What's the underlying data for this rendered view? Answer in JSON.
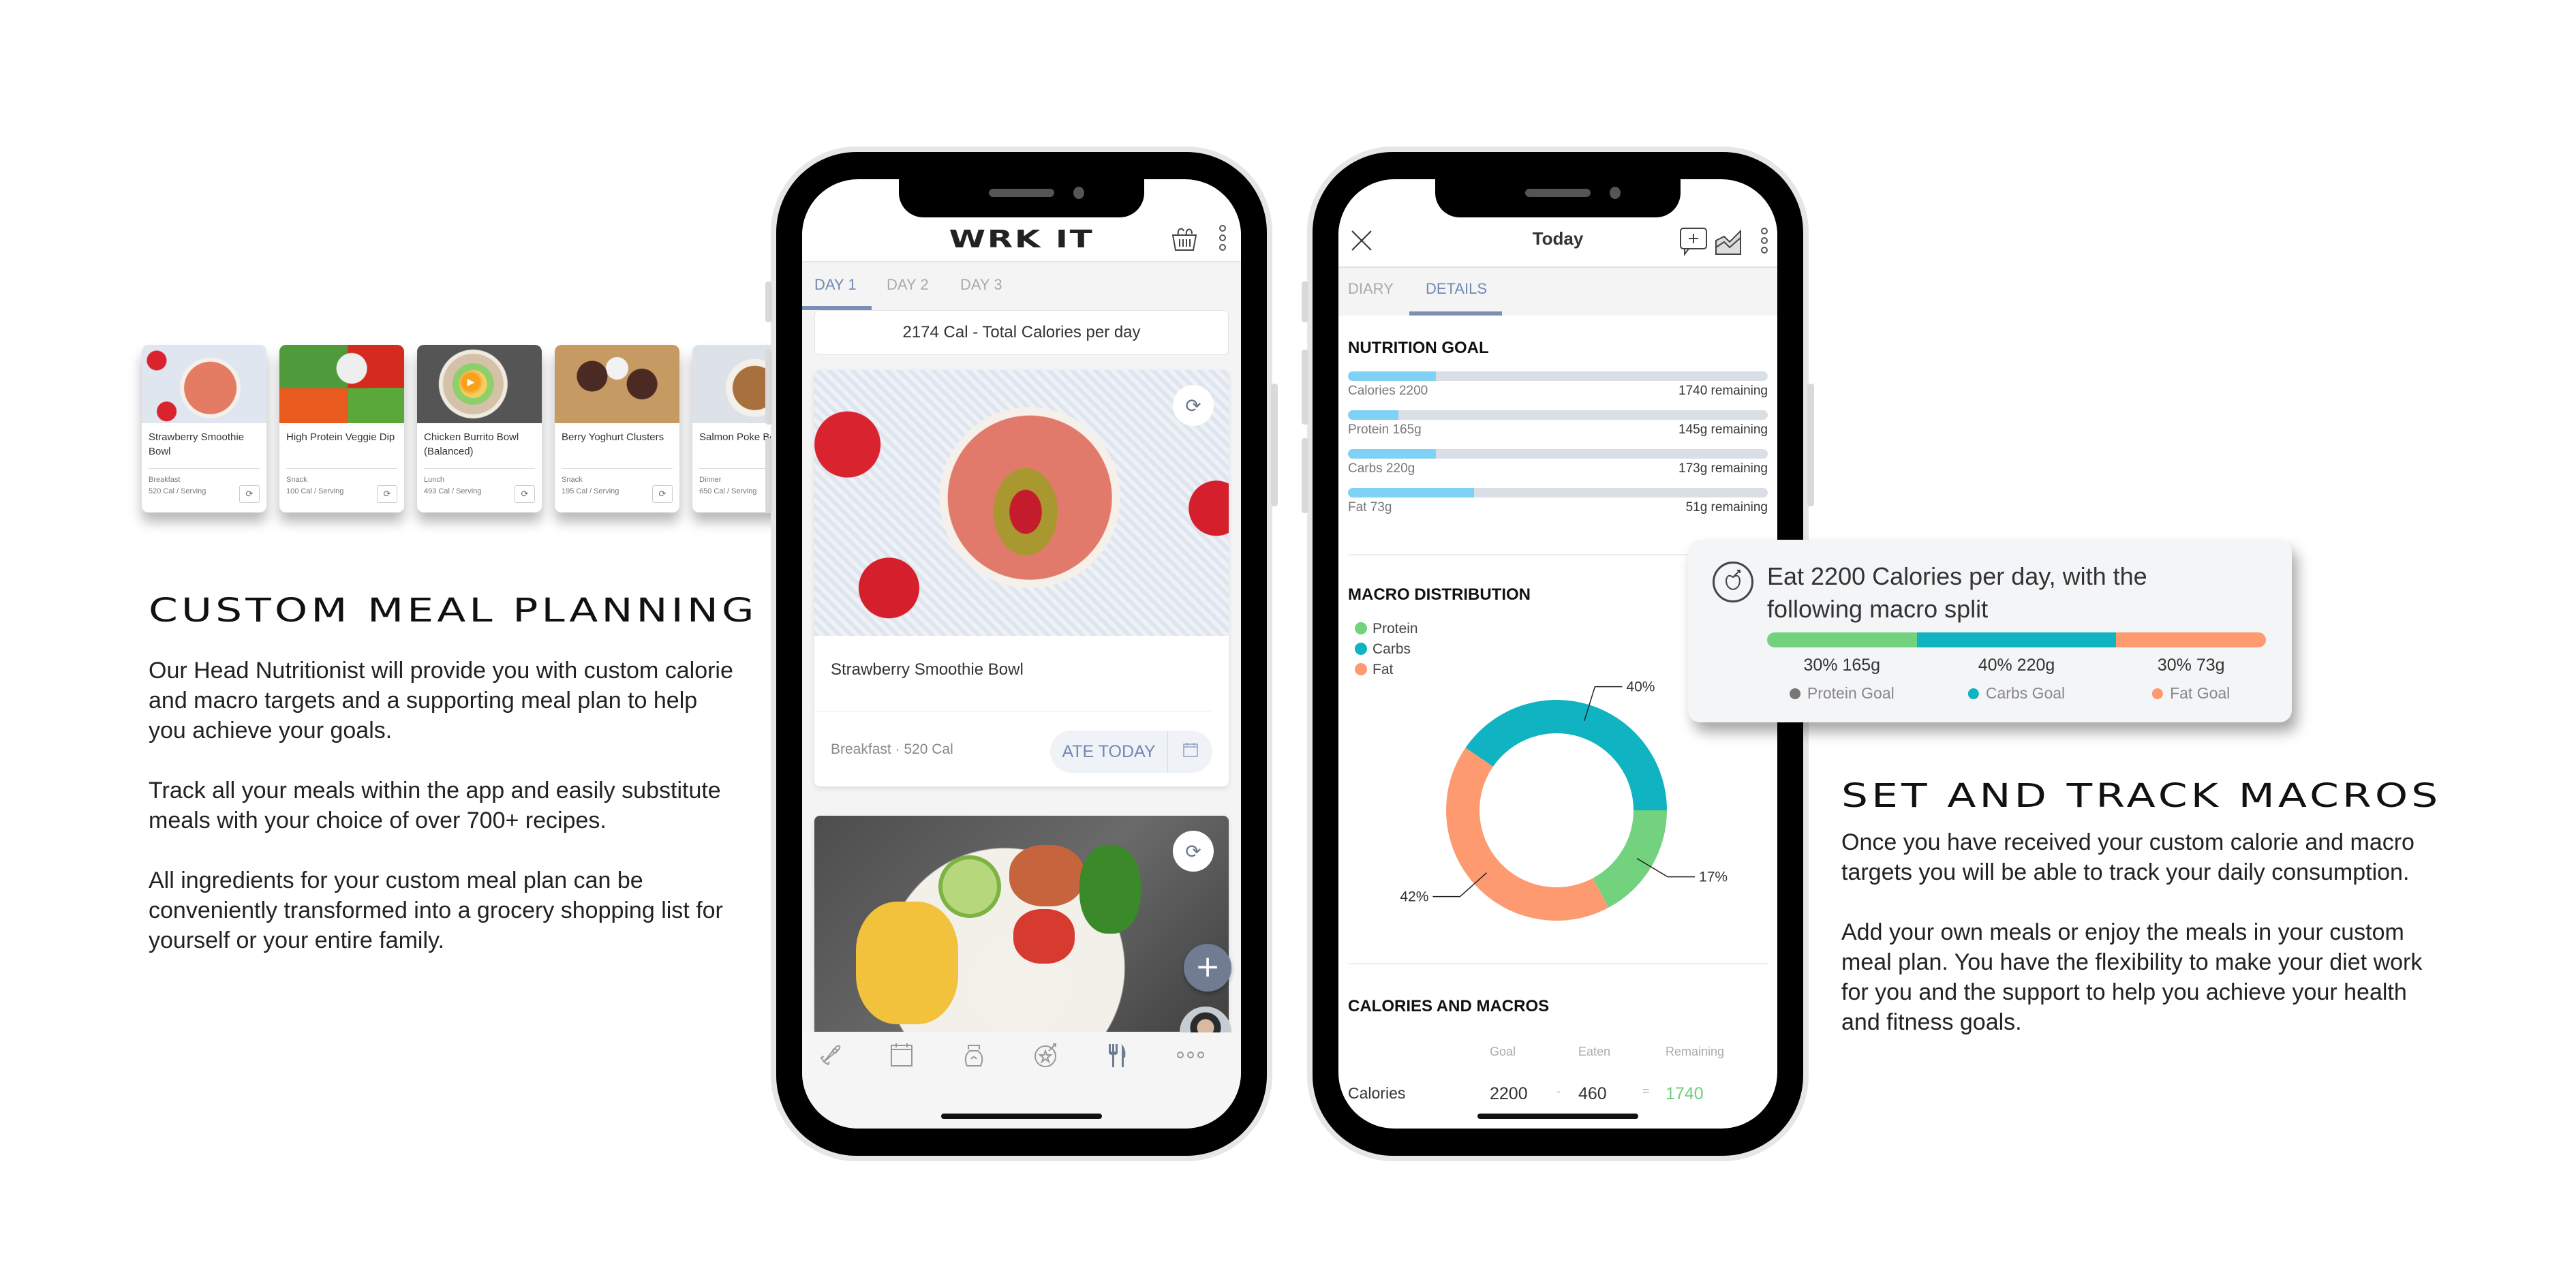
{
  "left_section": {
    "heading": "CUSTOM MEAL PLANNING",
    "paragraphs": [
      "Our Head Nutritionist will provide you with custom calorie and macro targets and a supporting meal plan to help you achieve your goals.",
      "Track all your meals within the app and easily substitute meals with your choice of over 700+ recipes.",
      "All ingredients for your custom meal plan can be conveniently transformed into a grocery shopping list for yourself or your entire family."
    ]
  },
  "right_section": {
    "heading": "SET AND TRACK MACROS",
    "paragraphs": [
      "Once you have received your custom calorie and macro targets you will be able to track your daily consumption.",
      "Add your own meals or enjoy the meals in your custom meal plan. You have the flexibility to make your diet work for you and the support to help you achieve your health and fitness goals."
    ]
  },
  "meal_strip": [
    {
      "name": "Strawberry Smoothie Bowl",
      "meal": "Breakfast",
      "calories": "520 Cal / Serving",
      "video": false
    },
    {
      "name": "High Protein Veggie Dip",
      "meal": "Snack",
      "calories": "100 Cal / Serving",
      "video": false
    },
    {
      "name": "Chicken Burrito Bowl (Balanced)",
      "meal": "Lunch",
      "calories": "493 Cal / Serving",
      "video": true
    },
    {
      "name": "Berry Yoghurt Clusters",
      "meal": "Snack",
      "calories": "195 Cal / Serving",
      "video": false
    },
    {
      "name": "Salmon Poke Bowl",
      "meal": "Dinner",
      "calories": "650 Cal / Serving",
      "video": false
    }
  ],
  "phone1": {
    "app_title": "WRK IT",
    "header_icons": [
      "grocery-basket-icon",
      "more-vertical-icon"
    ],
    "tabs": [
      {
        "label": "DAY 1",
        "active": true
      },
      {
        "label": "DAY 2",
        "active": false
      },
      {
        "label": "DAY 3",
        "active": false
      }
    ],
    "total_calories": "2174 Cal - Total Calories per day",
    "meal_card": {
      "title": "Strawberry Smoothie Bowl",
      "meta": "Breakfast · 520 Cal",
      "ate_today_label": "ATE TODAY"
    },
    "bottom_nav": [
      {
        "icon": "rocket-icon",
        "active": false
      },
      {
        "icon": "calendar-icon",
        "active": false
      },
      {
        "icon": "kettlebell-icon",
        "active": false
      },
      {
        "icon": "goal-star-icon",
        "active": false
      },
      {
        "icon": "fork-knife-icon",
        "active": true
      },
      {
        "icon": "more-horizontal-icon",
        "active": false
      }
    ],
    "fab_label": "+"
  },
  "phone2": {
    "title": "Today",
    "tabs": [
      {
        "label": "DIARY",
        "active": false
      },
      {
        "label": "DETAILS",
        "active": true
      }
    ],
    "nutrition_goal": {
      "title": "NUTRITION GOAL",
      "rows": [
        {
          "label": "Calories 2200",
          "remaining": "1740 remaining",
          "progress": 0.21
        },
        {
          "label": "Protein 165g",
          "remaining": "145g remaining",
          "progress": 0.12
        },
        {
          "label": "Carbs 220g",
          "remaining": "173g remaining",
          "progress": 0.21
        },
        {
          "label": "Fat 73g",
          "remaining": "51g remaining",
          "progress": 0.3
        }
      ]
    },
    "macro_distribution": {
      "title": "MACRO DISTRIBUTION",
      "legend": [
        "Protein",
        "Carbs",
        "Fat"
      ]
    },
    "calories_and_macros": {
      "title": "CALORIES AND MACROS",
      "columns": [
        "Goal",
        "Eaten",
        "Remaining"
      ],
      "rows": [
        {
          "label": "Calories",
          "goal": "2200",
          "op1": "-",
          "eaten": "460",
          "op2": "=",
          "remaining": "1740"
        }
      ]
    }
  },
  "goal_card": {
    "text": "Eat 2200 Calories per day, with the following macro split",
    "segments": [
      {
        "name": "Protein Goal",
        "value": "30% 165g",
        "percent": 30,
        "color": "#72d27e",
        "legend_dot": "#777777"
      },
      {
        "name": "Carbs Goal",
        "value": "40% 220g",
        "percent": 40,
        "color": "#10b3c2",
        "legend_dot": "#10b3c2"
      },
      {
        "name": "Fat Goal",
        "value": "30% 73g",
        "percent": 30,
        "color": "#fe9a70",
        "legend_dot": "#fe9a70"
      }
    ]
  },
  "colors": {
    "accent": "#7389b0",
    "protein": "#72d27e",
    "carbs": "#10b3c2",
    "fat": "#fe9a70",
    "progress": "#7fd1f5",
    "remaining_green": "#6cd07a"
  },
  "chart_data": {
    "type": "pie",
    "title": "MACRO DISTRIBUTION",
    "donut": true,
    "start_angle_deg": 0,
    "direction": "clockwise",
    "slices": [
      {
        "label": "Protein",
        "value": 17,
        "display": "17%",
        "color": "#72d27e"
      },
      {
        "label": "Fat",
        "value": 42,
        "display": "42%",
        "color": "#fe9a70"
      },
      {
        "label": "Carbs",
        "value": 40,
        "display": "40%",
        "color": "#10b3c2"
      }
    ],
    "legend": [
      "Protein",
      "Carbs",
      "Fat"
    ],
    "legend_position": "top-left"
  }
}
